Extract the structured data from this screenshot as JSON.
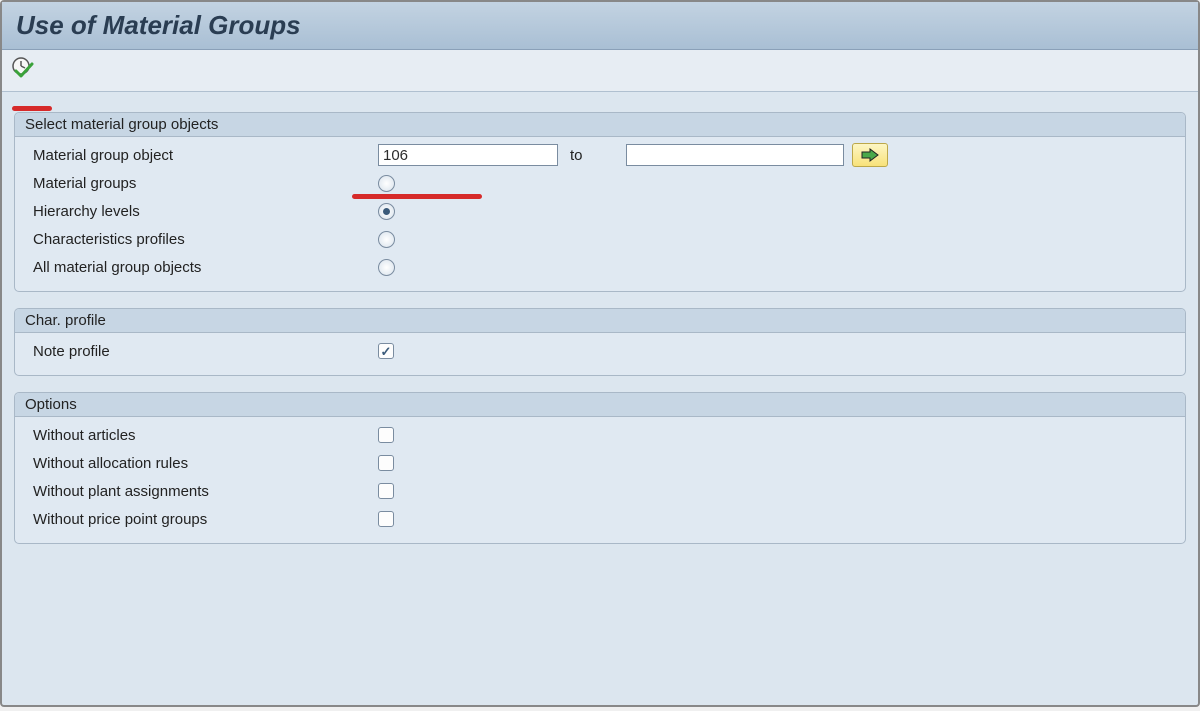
{
  "title": "Use of Material Groups",
  "group1": {
    "header": "Select material group objects",
    "object_row": {
      "label": "Material group object",
      "from_value": "106",
      "to_label": "to",
      "to_value": ""
    },
    "radios": {
      "material_groups": "Material groups",
      "hierarchy_levels": "Hierarchy levels",
      "char_profiles": "Characteristics profiles",
      "all_objects": "All material group objects",
      "selected": "hierarchy_levels"
    }
  },
  "group2": {
    "header": "Char. profile",
    "note_profile_label": "Note profile",
    "note_profile_checked": true
  },
  "group3": {
    "header": "Options",
    "items": {
      "without_articles": {
        "label": "Without articles",
        "checked": false
      },
      "without_alloc": {
        "label": "Without allocation rules",
        "checked": false
      },
      "without_plant": {
        "label": "Without plant assignments",
        "checked": false
      },
      "without_price": {
        "label": "Without price point groups",
        "checked": false
      }
    }
  }
}
